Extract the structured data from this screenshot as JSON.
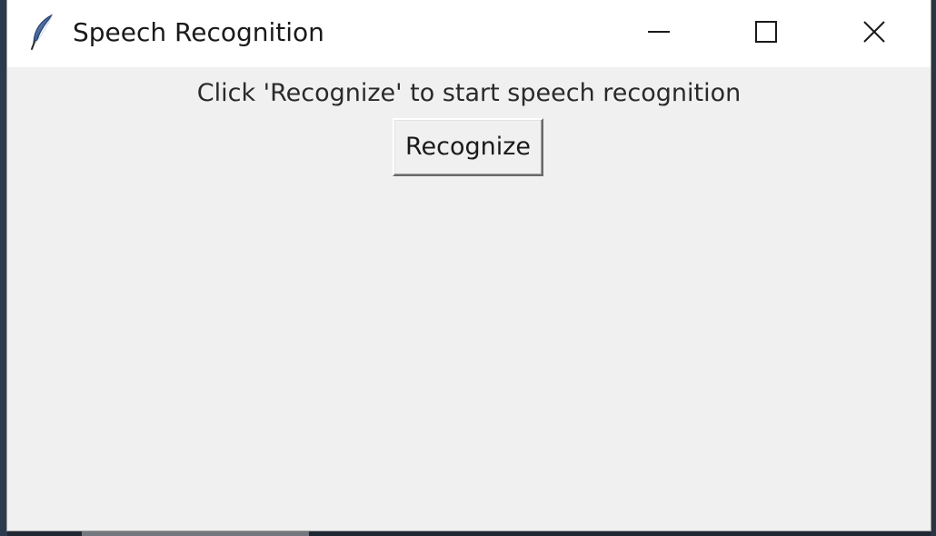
{
  "window": {
    "title": "Speech Recognition",
    "icon": "feather-icon",
    "controls": {
      "minimize_icon": "minimize-icon",
      "maximize_icon": "maximize-icon",
      "close_icon": "close-icon"
    }
  },
  "main": {
    "prompt": "Click 'Recognize' to start speech recognition",
    "recognize_label": "Recognize"
  },
  "colors": {
    "titlebar_bg": "#ffffff",
    "client_bg": "#f0f0f0",
    "text": "#2a2a2a"
  }
}
